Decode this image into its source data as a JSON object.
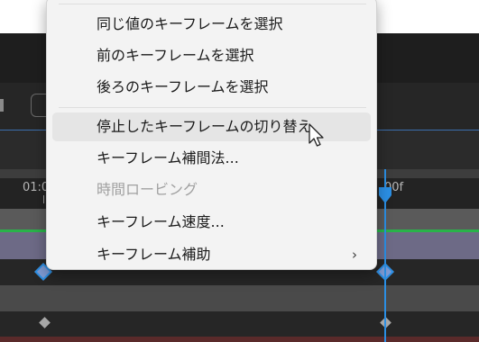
{
  "timeline": {
    "ruler_labels": [
      "01:0",
      "00f"
    ]
  },
  "menu": {
    "items": [
      {
        "label": "同じ値のキーフレームを選択"
      },
      {
        "label": "前のキーフレームを選択"
      },
      {
        "label": "後ろのキーフレームを選択"
      },
      {
        "label": "停止したキーフレームの切り替え"
      },
      {
        "label": "キーフレーム補間法..."
      },
      {
        "label": "時間ロービング"
      },
      {
        "label": "キーフレーム速度..."
      },
      {
        "label": "キーフレーム補助"
      }
    ],
    "hovered_item": "停止したキーフレームの切り替え",
    "disabled_item": "時間ロービング",
    "submenu_item": "キーフレーム補助"
  },
  "colors": {
    "menu_bg": "#f3f3f3",
    "hover_bg": "#e5e5e5",
    "playhead": "#2b8fe4",
    "green_band": "#29b34a",
    "purple_band": "#6d6a86"
  }
}
